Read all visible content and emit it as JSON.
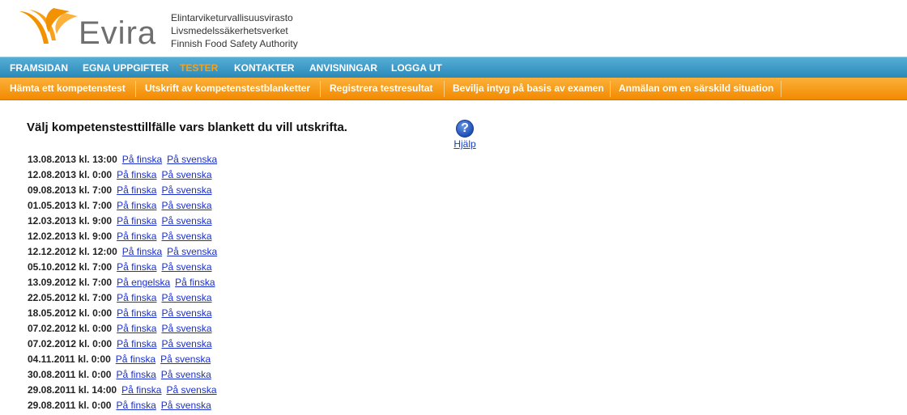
{
  "header": {
    "logo_text": "Evira",
    "agency_lines": [
      "Elintarviketurvallisuusvirasto",
      "Livsmedelssäkerhetsverket",
      "Finnish Food Safety Authority"
    ]
  },
  "nav": {
    "items": [
      "FRAMSIDAN",
      "EGNA UPPGIFTER",
      "TESTER",
      "KONTAKTER",
      "ANVISNINGAR",
      "LOGGA UT"
    ],
    "active": "TESTER"
  },
  "subnav": {
    "items": [
      "Hämta ett kompetenstest",
      "Utskrift av kompetenstestblanketter",
      "Registrera testresultat",
      "Bevilja intyg på basis av examen",
      "Anmälan om en särskild situation"
    ]
  },
  "main": {
    "title": "Välj kompetenstesttillfälle vars blankett du vill utskrifta.",
    "help_label": "Hjälp",
    "sessions": [
      {
        "date": "13.08.2013 kl. 13:00",
        "links": [
          "På finska",
          "På svenska"
        ]
      },
      {
        "date": "12.08.2013 kl. 0:00",
        "links": [
          "På finska",
          "På svenska"
        ]
      },
      {
        "date": "09.08.2013 kl. 7:00",
        "links": [
          "På finska",
          "På svenska"
        ]
      },
      {
        "date": "01.05.2013 kl. 7:00",
        "links": [
          "På finska",
          "På svenska"
        ]
      },
      {
        "date": "12.03.2013 kl. 9:00",
        "links": [
          "På finska",
          "På svenska"
        ]
      },
      {
        "date": "12.02.2013 kl. 9:00",
        "links": [
          "På finska",
          "På svenska"
        ]
      },
      {
        "date": "12.12.2012 kl. 12:00",
        "links": [
          "På finska",
          "På svenska"
        ]
      },
      {
        "date": "05.10.2012 kl. 7:00",
        "links": [
          "På finska",
          "På svenska"
        ]
      },
      {
        "date": "13.09.2012 kl. 7:00",
        "links": [
          "På engelska",
          "På finska"
        ]
      },
      {
        "date": "22.05.2012 kl. 7:00",
        "links": [
          "På finska",
          "På svenska"
        ]
      },
      {
        "date": "18.05.2012 kl. 0:00",
        "links": [
          "På finska",
          "På svenska"
        ]
      },
      {
        "date": "07.02.2012 kl. 0:00",
        "links": [
          "På finska",
          "På svenska"
        ]
      },
      {
        "date": "07.02.2012 kl. 0:00",
        "links": [
          "På finska",
          "På svenska"
        ]
      },
      {
        "date": "04.11.2011 kl. 0:00",
        "links": [
          "På finska",
          "På svenska"
        ]
      },
      {
        "date": "30.08.2011 kl. 0:00",
        "links": [
          "På finska",
          "På svenska"
        ]
      },
      {
        "date": "29.08.2011 kl. 14:00",
        "links": [
          "På finska",
          "På svenska"
        ]
      },
      {
        "date": "29.08.2011 kl. 0:00",
        "links": [
          "På finska",
          "På svenska"
        ]
      }
    ]
  },
  "colors": {
    "nav_blue": "#3a98c4",
    "nav_orange": "#f7a11b",
    "link": "#1a2fcc"
  }
}
